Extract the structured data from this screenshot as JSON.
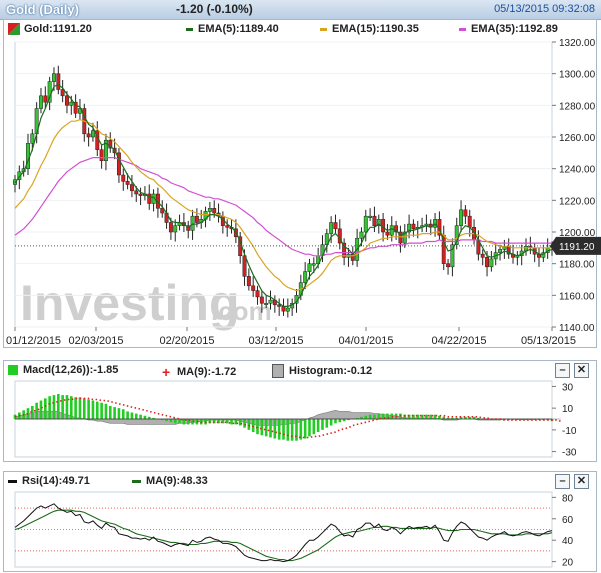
{
  "header": {
    "title": "Gold (Daily)",
    "change": "-1.20 (-0.10%)",
    "timestamp": "05/13/2015 09:32:08"
  },
  "price_legend": [
    {
      "label": "Gold:1191.20",
      "color": "#2a9d2a"
    },
    {
      "label": "EMA(5):1189.40",
      "color": "#1e6b1e"
    },
    {
      "label": "EMA(15):1190.35",
      "color": "#d9a520"
    },
    {
      "label": "EMA(35):1192.89",
      "color": "#d34fd3"
    }
  ],
  "price_tag": "1191.20",
  "watermark": "Investing.com",
  "x_ticks": [
    "01/12/2015",
    "02/03/2015",
    "02/20/2015",
    "03/12/2015",
    "04/01/2015",
    "04/22/2015",
    "05/13/2015"
  ],
  "price_y_ticks": [
    "1320.00",
    "1300.00",
    "1280.00",
    "1260.00",
    "1240.00",
    "1220.00",
    "1200.00",
    "1180.00",
    "1160.00",
    "1140.00"
  ],
  "macd_legend": [
    {
      "label": "Macd(12,26)):-1.85",
      "color": "#22cc22"
    },
    {
      "label": "MA(9):-1.72",
      "color": "#e02020"
    },
    {
      "label": "Histogram:-0.12",
      "color": "#b0b0b0"
    }
  ],
  "macd_y_ticks": [
    "30",
    "10",
    "-10",
    "-30"
  ],
  "rsi_legend": [
    {
      "label": "Rsi(14):49.71",
      "color": "#000000"
    },
    {
      "label": "MA(9):48.33",
      "color": "#1e6b1e"
    }
  ],
  "rsi_y_ticks": [
    "80",
    "60",
    "40",
    "20"
  ],
  "buttons": {
    "minimize": "–",
    "close": "✕"
  },
  "colors": {
    "up": "#36c236",
    "down": "#d42020",
    "ema5": "#1e6b1e",
    "ema15": "#d9a520",
    "ema35": "#d34fd3",
    "rsi": "#111111",
    "rsi_ma": "#1e6b1e",
    "macd_bar": "#22cc22",
    "macd_signal": "#e02020",
    "histogram": "#b0b0b0"
  },
  "chart_data": [
    {
      "type": "candlestick",
      "title": "Gold (Daily)",
      "ylim": [
        1140,
        1320
      ],
      "x_ticks": [
        "01/12/2015",
        "02/03/2015",
        "02/20/2015",
        "03/12/2015",
        "04/01/2015",
        "04/22/2015",
        "05/13/2015"
      ],
      "close": [
        1233,
        1238,
        1240,
        1256,
        1262,
        1278,
        1286,
        1282,
        1295,
        1300,
        1290,
        1286,
        1280,
        1282,
        1275,
        1278,
        1262,
        1260,
        1264,
        1252,
        1245,
        1258,
        1253,
        1250,
        1236,
        1232,
        1230,
        1226,
        1224,
        1223,
        1224,
        1218,
        1224,
        1215,
        1212,
        1206,
        1200,
        1204,
        1206,
        1204,
        1201,
        1210,
        1206,
        1208,
        1213,
        1215,
        1212,
        1210,
        1204,
        1203,
        1202,
        1197,
        1185,
        1172,
        1166,
        1163,
        1159,
        1155,
        1155,
        1157,
        1154,
        1153,
        1150,
        1152,
        1155,
        1160,
        1168,
        1175,
        1180,
        1180,
        1185,
        1192,
        1199,
        1206,
        1202,
        1193,
        1184,
        1186,
        1182,
        1196,
        1200,
        1210,
        1210,
        1204,
        1208,
        1200,
        1198,
        1204,
        1200,
        1193,
        1200,
        1205,
        1202,
        1203,
        1204,
        1205,
        1203,
        1208,
        1198,
        1180,
        1178,
        1192,
        1204,
        1214,
        1210,
        1203,
        1195,
        1186,
        1184,
        1178,
        1183,
        1187,
        1189,
        1191,
        1186,
        1184,
        1185,
        1188,
        1191,
        1190,
        1186,
        1184,
        1187,
        1190,
        1191
      ],
      "ema5": [
        1231,
        1235,
        1238,
        1245,
        1252,
        1262,
        1272,
        1278,
        1285,
        1292,
        1293,
        1291,
        1287,
        1284,
        1280,
        1279,
        1273,
        1268,
        1266,
        1260,
        1255,
        1256,
        1254,
        1252,
        1246,
        1241,
        1236,
        1232,
        1228,
        1225,
        1224,
        1222,
        1222,
        1219,
        1216,
        1212,
        1207,
        1206,
        1206,
        1205,
        1203,
        1205,
        1205,
        1206,
        1208,
        1211,
        1211,
        1210,
        1208,
        1205,
        1203,
        1200,
        1194,
        1186,
        1179,
        1173,
        1168,
        1163,
        1160,
        1159,
        1157,
        1155,
        1153,
        1153,
        1154,
        1156,
        1160,
        1166,
        1172,
        1175,
        1179,
        1185,
        1191,
        1197,
        1199,
        1196,
        1191,
        1189,
        1186,
        1189,
        1193,
        1199,
        1203,
        1203,
        1205,
        1203,
        1201,
        1202,
        1201,
        1198,
        1199,
        1201,
        1201,
        1202,
        1203,
        1204,
        1203,
        1205,
        1202,
        1194,
        1188,
        1189,
        1194,
        1201,
        1204,
        1203,
        1200,
        1195,
        1190,
        1185,
        1184,
        1185,
        1186,
        1188,
        1187,
        1186,
        1185,
        1186,
        1188,
        1189,
        1188,
        1186,
        1186,
        1188,
        1189
      ],
      "ema15": [
        1215,
        1218,
        1221,
        1226,
        1230,
        1236,
        1242,
        1247,
        1253,
        1259,
        1263,
        1266,
        1268,
        1270,
        1270,
        1271,
        1270,
        1269,
        1268,
        1265,
        1262,
        1261,
        1259,
        1257,
        1254,
        1251,
        1248,
        1244,
        1241,
        1238,
        1236,
        1234,
        1233,
        1230,
        1228,
        1225,
        1222,
        1220,
        1218,
        1216,
        1214,
        1213,
        1212,
        1211,
        1211,
        1211,
        1211,
        1211,
        1210,
        1209,
        1208,
        1206,
        1203,
        1199,
        1195,
        1191,
        1186,
        1182,
        1178,
        1175,
        1172,
        1170,
        1167,
        1165,
        1164,
        1163,
        1164,
        1165,
        1167,
        1169,
        1171,
        1174,
        1178,
        1182,
        1184,
        1185,
        1185,
        1185,
        1185,
        1186,
        1188,
        1190,
        1193,
        1194,
        1195,
        1196,
        1196,
        1197,
        1197,
        1197,
        1197,
        1198,
        1198,
        1198,
        1199,
        1199,
        1199,
        1200,
        1200,
        1198,
        1195,
        1195,
        1196,
        1198,
        1199,
        1199,
        1199,
        1198,
        1196,
        1194,
        1193,
        1192,
        1191,
        1191,
        1191,
        1190,
        1190,
        1190,
        1190,
        1190,
        1190,
        1190,
        1190,
        1190,
        1190
      ],
      "ema35": [
        1198,
        1200,
        1202,
        1205,
        1208,
        1212,
        1216,
        1220,
        1224,
        1228,
        1232,
        1235,
        1238,
        1240,
        1242,
        1244,
        1245,
        1246,
        1247,
        1247,
        1247,
        1247,
        1247,
        1247,
        1246,
        1245,
        1244,
        1243,
        1242,
        1240,
        1239,
        1238,
        1237,
        1236,
        1234,
        1233,
        1231,
        1230,
        1229,
        1228,
        1226,
        1225,
        1224,
        1223,
        1222,
        1222,
        1221,
        1221,
        1220,
        1219,
        1218,
        1217,
        1215,
        1213,
        1211,
        1209,
        1206,
        1204,
        1201,
        1199,
        1197,
        1195,
        1193,
        1191,
        1189,
        1188,
        1187,
        1186,
        1186,
        1185,
        1185,
        1185,
        1186,
        1186,
        1187,
        1187,
        1187,
        1187,
        1187,
        1187,
        1188,
        1189,
        1190,
        1190,
        1191,
        1191,
        1191,
        1192,
        1192,
        1192,
        1192,
        1193,
        1193,
        1193,
        1193,
        1194,
        1194,
        1194,
        1195,
        1194,
        1194,
        1194,
        1194,
        1195,
        1195,
        1195,
        1195,
        1195,
        1194,
        1194,
        1194,
        1193,
        1193,
        1193,
        1193,
        1193,
        1193,
        1193,
        1193,
        1193,
        1193,
        1193,
        1193,
        1193,
        1193
      ],
      "series_names": [
        "Gold",
        "EMA(5)",
        "EMA(15)",
        "EMA(35)"
      ]
    },
    {
      "type": "bar",
      "title": "Macd(12,26)",
      "ylim": [
        -35,
        35
      ],
      "y_ticks": [
        30,
        10,
        -10,
        -30
      ],
      "macd": [
        4,
        6,
        8,
        10,
        12,
        15,
        17,
        19,
        21,
        22,
        23,
        22,
        22,
        21,
        20,
        20,
        19,
        18,
        17,
        16,
        15,
        14,
        12,
        11,
        10,
        9,
        7,
        6,
        5,
        4,
        3,
        2,
        1,
        0,
        -1,
        -2,
        -3,
        -4,
        -4,
        -5,
        -5,
        -5,
        -5,
        -5,
        -5,
        -4,
        -4,
        -4,
        -4,
        -4,
        -5,
        -5,
        -6,
        -8,
        -10,
        -12,
        -14,
        -15,
        -16,
        -17,
        -18,
        -19,
        -19,
        -20,
        -20,
        -20,
        -19,
        -18,
        -16,
        -14,
        -12,
        -10,
        -8,
        -6,
        -4,
        -3,
        -2,
        -1,
        0,
        1,
        2,
        3,
        4,
        4,
        5,
        5,
        5,
        5,
        5,
        5,
        4,
        4,
        4,
        4,
        4,
        4,
        4,
        4,
        3,
        2,
        1,
        1,
        1,
        2,
        2,
        2,
        2,
        1,
        0,
        -1,
        -1,
        -1,
        -1,
        -1,
        -1,
        -1,
        -1,
        -1,
        -1,
        -1,
        -1,
        -1,
        -1,
        -1,
        -2
      ],
      "signal": [
        2,
        3,
        4,
        5,
        7,
        8,
        10,
        12,
        14,
        15,
        16,
        17,
        18,
        18,
        19,
        19,
        19,
        19,
        18,
        18,
        17,
        17,
        16,
        15,
        14,
        13,
        12,
        11,
        10,
        9,
        8,
        7,
        6,
        5,
        4,
        3,
        2,
        1,
        0,
        -1,
        -1,
        -2,
        -2,
        -3,
        -3,
        -3,
        -3,
        -3,
        -3,
        -3,
        -4,
        -4,
        -4,
        -5,
        -6,
        -7,
        -8,
        -9,
        -10,
        -11,
        -12,
        -13,
        -14,
        -15,
        -16,
        -16,
        -17,
        -17,
        -17,
        -16,
        -16,
        -15,
        -14,
        -13,
        -12,
        -10,
        -9,
        -8,
        -6,
        -5,
        -4,
        -3,
        -2,
        -1,
        0,
        1,
        1,
        2,
        2,
        3,
        3,
        3,
        3,
        3,
        3,
        3,
        3,
        3,
        3,
        3,
        2,
        2,
        2,
        2,
        2,
        2,
        2,
        2,
        1,
        1,
        0,
        0,
        0,
        -1,
        -1,
        -1,
        -1,
        -1,
        -1,
        -1,
        -1,
        -1,
        -1,
        -1,
        -1,
        -1,
        -2
      ],
      "histogram": [
        2,
        3,
        4,
        5,
        5,
        7,
        7,
        7,
        7,
        7,
        7,
        5,
        4,
        3,
        1,
        1,
        0,
        -1,
        -1,
        -2,
        -2,
        -3,
        -4,
        -4,
        -4,
        -4,
        -5,
        -5,
        -5,
        -5,
        -5,
        -5,
        -5,
        -5,
        -5,
        -5,
        -5,
        -5,
        -4,
        -4,
        -4,
        -3,
        -3,
        -2,
        -2,
        -1,
        -1,
        -1,
        -1,
        -1,
        -1,
        -1,
        -2,
        -3,
        -4,
        -5,
        -6,
        -6,
        -6,
        -6,
        -6,
        -6,
        -5,
        -5,
        -4,
        -4,
        -2,
        -1,
        1,
        2,
        4,
        5,
        6,
        7,
        8,
        7,
        7,
        7,
        6,
        6,
        6,
        6,
        6,
        5,
        5,
        4,
        4,
        3,
        3,
        2,
        1,
        1,
        1,
        1,
        1,
        1,
        1,
        1,
        0,
        -1,
        -1,
        -1,
        -1,
        0,
        0,
        0,
        0,
        -1,
        -1,
        -1,
        -1,
        -1,
        -1,
        0,
        0,
        0,
        0,
        0,
        0,
        0,
        0,
        0,
        0,
        0,
        0,
        0,
        0
      ]
    },
    {
      "type": "line",
      "title": "Rsi(14)",
      "ylim": [
        15,
        85
      ],
      "y_ticks": [
        80,
        60,
        40,
        20
      ],
      "rsi": [
        52,
        55,
        58,
        62,
        66,
        70,
        72,
        70,
        72,
        74,
        70,
        68,
        66,
        67,
        63,
        64,
        57,
        56,
        58,
        54,
        51,
        56,
        53,
        52,
        46,
        45,
        44,
        42,
        42,
        41,
        42,
        40,
        43,
        39,
        38,
        36,
        34,
        36,
        37,
        36,
        35,
        40,
        38,
        39,
        42,
        43,
        41,
        40,
        37,
        37,
        36,
        34,
        30,
        26,
        24,
        23,
        22,
        21,
        21,
        22,
        21,
        21,
        20,
        21,
        23,
        26,
        31,
        36,
        40,
        40,
        43,
        47,
        51,
        55,
        53,
        48,
        44,
        45,
        43,
        50,
        52,
        56,
        56,
        52,
        55,
        50,
        49,
        52,
        50,
        46,
        50,
        53,
        51,
        52,
        52,
        53,
        51,
        54,
        48,
        40,
        39,
        47,
        53,
        57,
        55,
        51,
        47,
        43,
        42,
        40,
        43,
        45,
        46,
        48,
        45,
        44,
        45,
        47,
        48,
        47,
        45,
        44,
        46,
        48,
        49
      ],
      "ma": [
        50,
        51,
        53,
        55,
        57,
        59,
        61,
        63,
        65,
        67,
        68,
        68,
        68,
        68,
        67,
        67,
        66,
        64,
        62,
        60,
        58,
        57,
        56,
        55,
        53,
        51,
        50,
        48,
        46,
        45,
        44,
        43,
        42,
        41,
        40,
        39,
        38,
        38,
        37,
        37,
        36,
        36,
        36,
        37,
        37,
        38,
        39,
        39,
        39,
        39,
        38,
        38,
        37,
        35,
        33,
        31,
        29,
        27,
        25,
        24,
        23,
        22,
        22,
        21,
        21,
        22,
        23,
        25,
        27,
        29,
        31,
        34,
        37,
        40,
        43,
        45,
        46,
        47,
        48,
        48,
        49,
        50,
        51,
        52,
        52,
        53,
        53,
        52,
        52,
        51,
        51,
        51,
        51,
        51,
        51,
        51,
        51,
        52,
        51,
        50,
        49,
        49,
        49,
        50,
        50,
        50,
        50,
        49,
        48,
        47,
        46,
        46,
        46,
        46,
        45,
        45,
        45,
        45,
        46,
        46,
        46,
        46,
        46,
        46,
        47
      ]
    }
  ]
}
